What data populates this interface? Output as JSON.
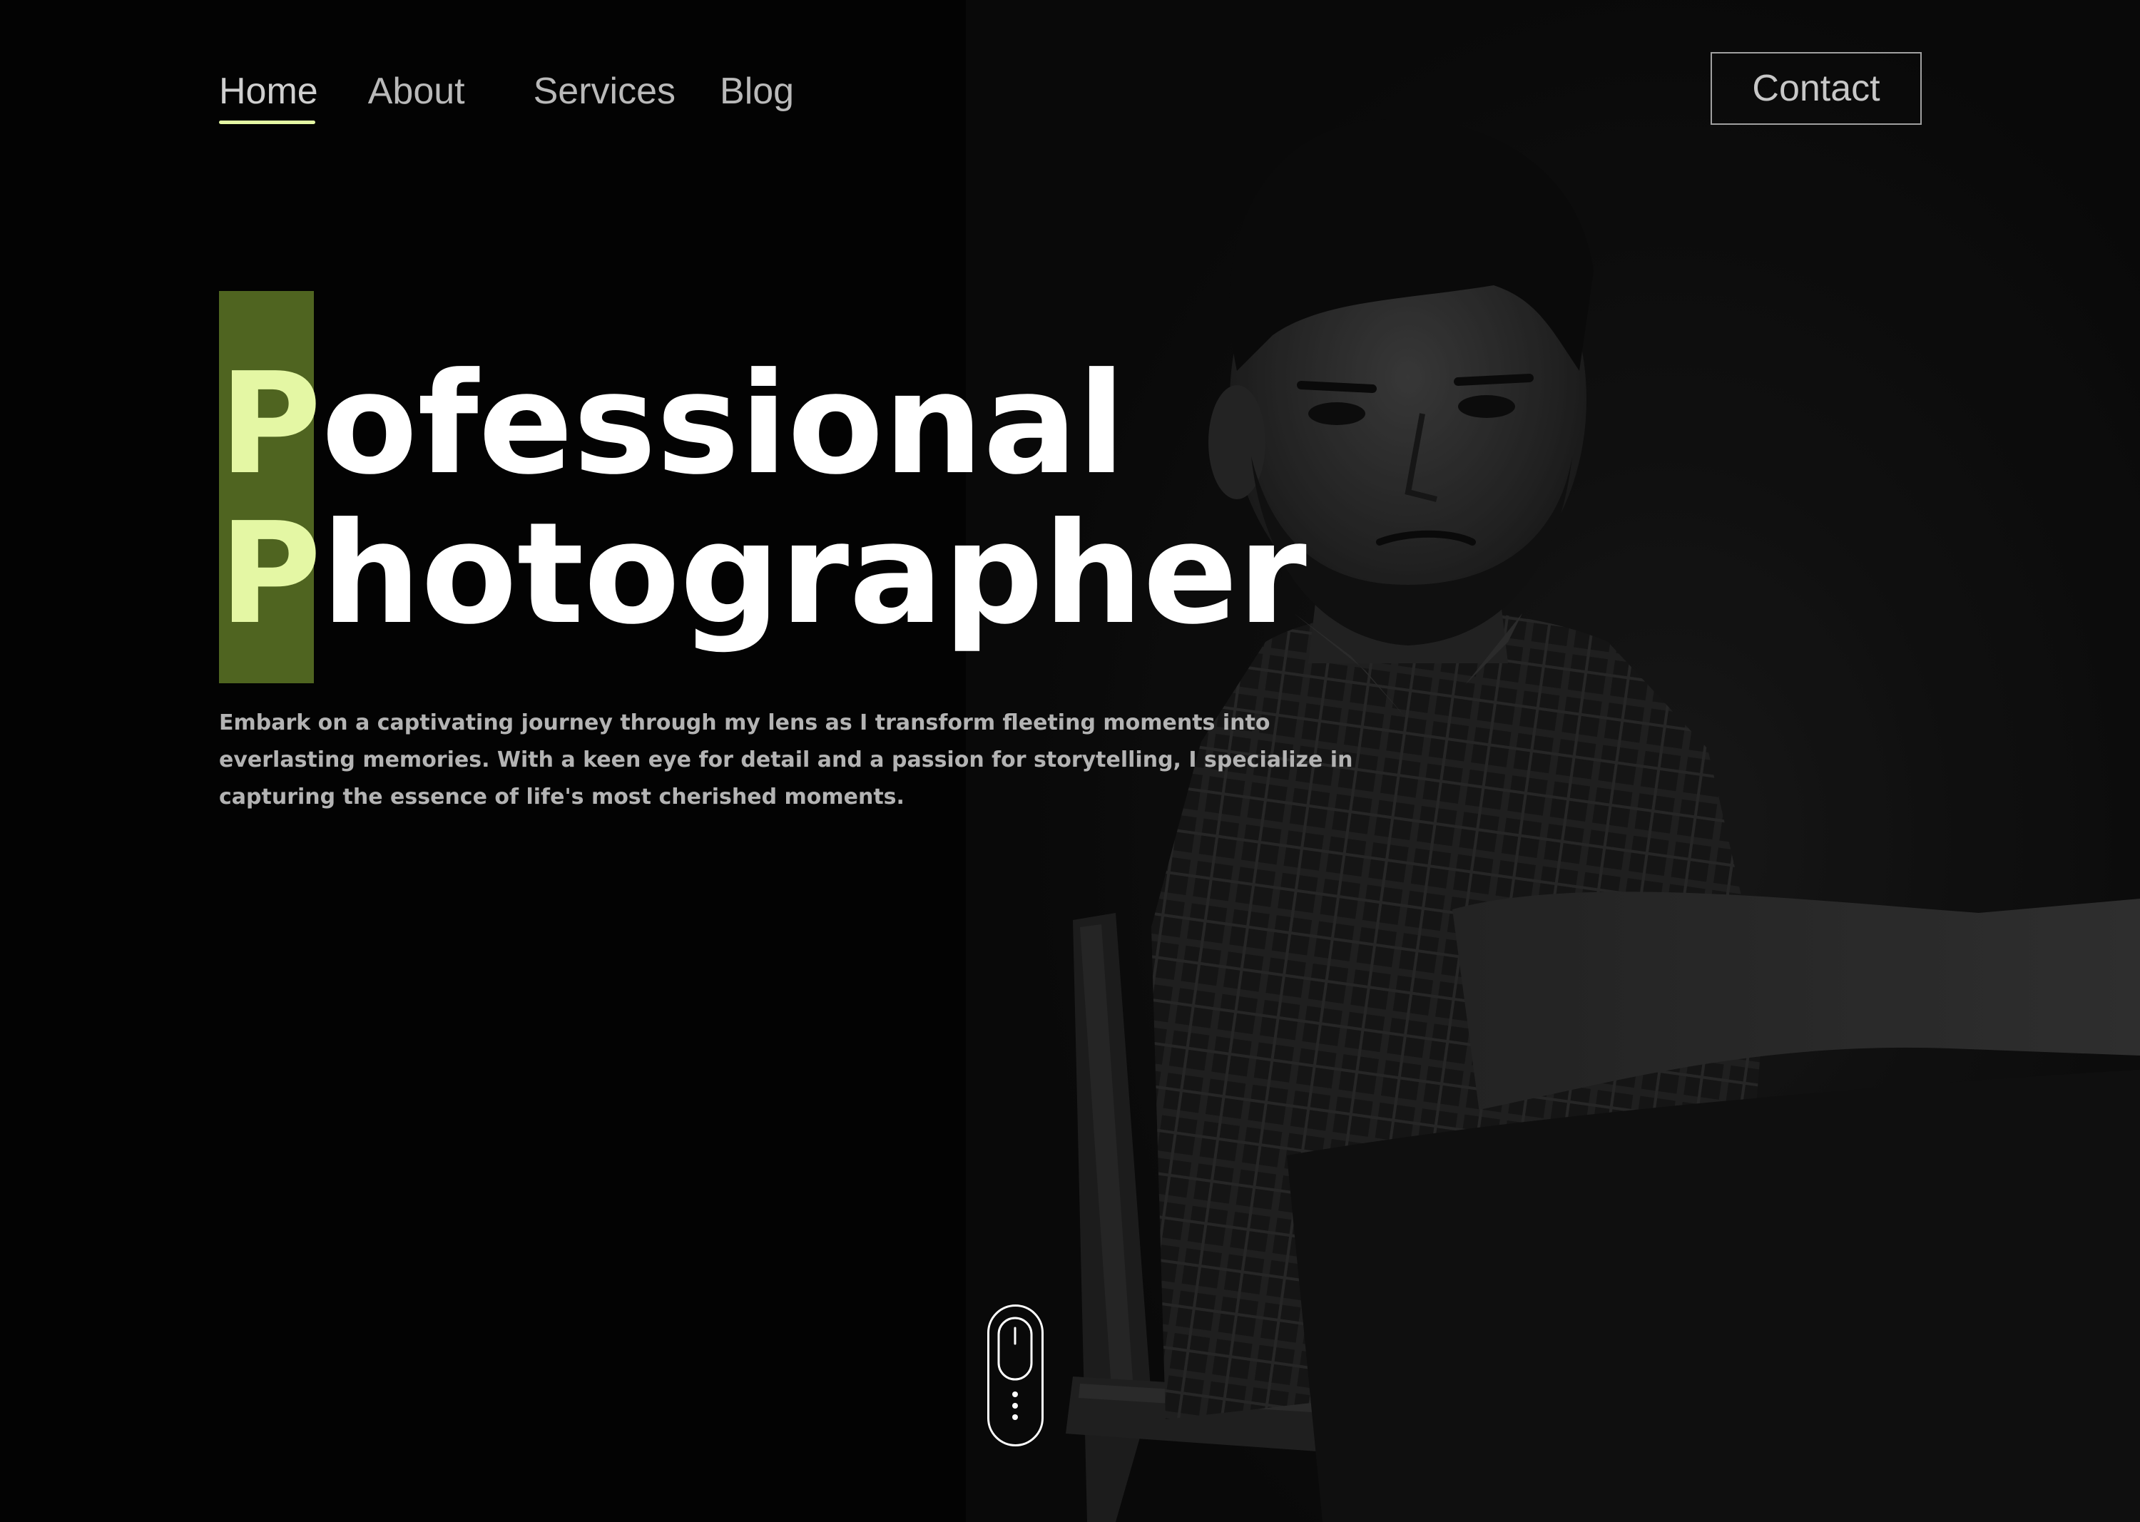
{
  "nav": {
    "links": [
      {
        "label": "Home",
        "active": true
      },
      {
        "label": "About"
      },
      {
        "label": "Services"
      },
      {
        "label": "Blog"
      }
    ],
    "contact_label": "Contact"
  },
  "hero": {
    "line1_initial": "P",
    "line1_rest": "ofessional",
    "line2_initial": "P",
    "line2_rest": "hotographer",
    "description": "Embark on a captivating journey through my lens as I transform fleeting moments into everlasting memories. With a keen eye for detail and a passion for storytelling, I specialize in capturing the essence of life's most cherished moments."
  },
  "icons": {
    "scroll": "mouse-scroll-icon"
  },
  "colors": {
    "background": "#030303",
    "accent": "#e4f7a4",
    "accent_block": "#4f6420",
    "text": "#ffffff",
    "muted_text": "#b3b3b3"
  }
}
